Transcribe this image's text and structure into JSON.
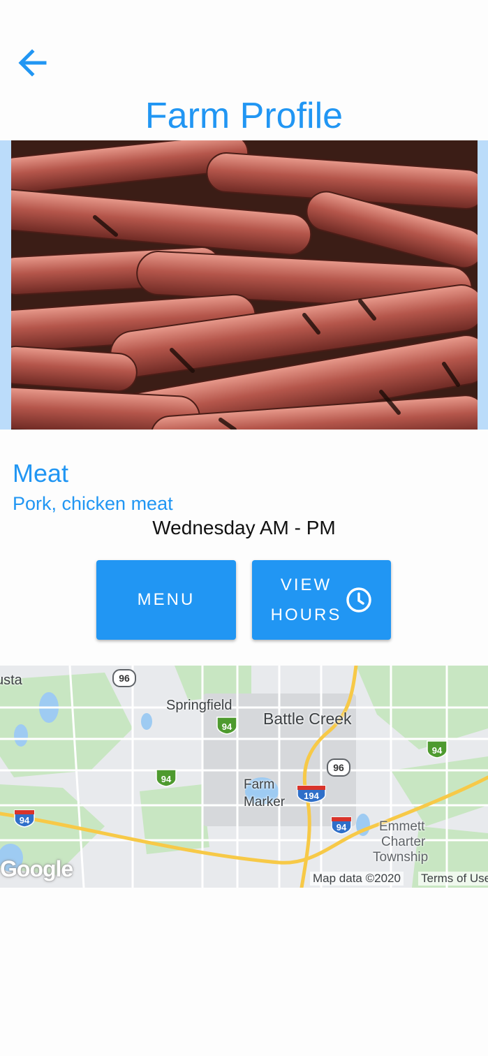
{
  "header": {
    "back_icon": "arrow-left-icon",
    "title": "Farm Profile"
  },
  "farm": {
    "photo_icon": "sausages-photo",
    "category": "Meat",
    "products": "Pork, chicken meat",
    "hours": "Wednesday AM - PM"
  },
  "actions": {
    "menu_label": "MENU",
    "view_hours_line1": "VIEW",
    "view_hours_line2": "HOURS",
    "view_hours_icon": "clock-icon"
  },
  "map": {
    "labels": {
      "usta": "usta",
      "springfield": "Springfield",
      "battle_creek": "Battle Creek",
      "farm_marker_1": "Farm",
      "farm_marker_2": "Marker",
      "emmett_1": "Emmett",
      "emmett_2": "Charter",
      "emmett_3": "Township"
    },
    "shields": {
      "r96a": "96",
      "r96b": "96",
      "i94a": "94",
      "i94b": "94",
      "i94c": "94",
      "i94d": "94",
      "i94e": "94",
      "i194": "194"
    },
    "logo": "Google",
    "attribution": "Map data ©2020",
    "terms": "Terms of Use"
  },
  "colors": {
    "accent": "#2196f3",
    "photo_frame": "#bbdcfa"
  }
}
